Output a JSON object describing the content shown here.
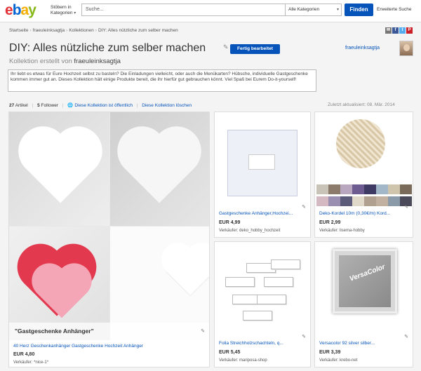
{
  "header": {
    "logo": [
      "e",
      "b",
      "a",
      "y"
    ],
    "browse_label": "Stöbern in Kategorien",
    "search_placeholder": "Suche...",
    "category_select": "Alle Kategorien",
    "find_button": "Finden",
    "advanced_search": "Erweiterte Suche"
  },
  "breadcrumb": [
    "Startseite",
    "fraeuleinksagtja",
    "Kollektionen",
    "DIY: Alles nützliche zum selber machen"
  ],
  "share_icons": [
    "mail-icon",
    "facebook-icon",
    "twitter-icon",
    "pinterest-icon"
  ],
  "collection": {
    "title": "DIY: Alles nützliche zum selber machen",
    "edit_button": "Fertig bearbeitet",
    "subtitle_prefix": "Kollektion erstellt von",
    "creator": "fraeuleinksagtja",
    "user_link": "fraeuleinksagtja",
    "description": "Ihr liebt es etwas für Eure Hochzeit selbst zu basteln? Die Einladungen vielleicht, oder auch die Menükarten? Hübsche, individuelle Gastgeschenke kommen immer gut an. Dieses Kollektion hält einige Produkte bereit, die ihr hierfür gut gebrauchen könnt. Viel Spaß bei Eurem Do-it-yourself!"
  },
  "stats": {
    "articles_count": "27",
    "articles_label": "Artikel",
    "followers_count": "5",
    "followers_label": "Follower",
    "public_link": "Diese Kollektion ist öffentlich",
    "delete_link": "Diese Kollektion löschen",
    "updated": "Zuletzt aktualisiert: 08. Mär. 2014"
  },
  "items": [
    {
      "overlay_label": "\"Gastgeschenke Anhänger\"",
      "name": "40 Herz Geschenkanhänger Gastgeschenke Hochzeit Anhänger",
      "price": "EUR 4,80",
      "seller": "Verkäufer: *nice-1*"
    },
    {
      "name": "Gastgeschenke Anhänger,Hochzei...",
      "price": "EUR 4,99",
      "seller": "Verkäufer: deko_hobby_hochzeit"
    },
    {
      "name": "Deko-Kordel 10m (0,30€/m) Kord...",
      "price": "EUR 2,99",
      "seller": "Verkäufer: lisema-hobby"
    },
    {
      "name": "Folia Streichholzschachteln, q...",
      "price": "EUR 5,45",
      "seller": "Verkäufer: mariposa-shop"
    },
    {
      "name": "Versacolor 92 silver silber...",
      "price": "EUR 3,39",
      "seller": "Verkäufer: krebo-net",
      "pad_label": "VersaColor"
    }
  ],
  "swatch_colors": [
    "#c9c3b7",
    "#8c7a6b",
    "#b8a7bf",
    "#6e5b8f",
    "#3e3a63",
    "#a2b8c8",
    "#cfc5ad",
    "#7a6a5a",
    "#d4b8c2",
    "#9a8fb0",
    "#5c5c7a",
    "#e0d8c8",
    "#b0a090",
    "#c2b0a0",
    "#8a9aa8",
    "#4a4a5a"
  ]
}
